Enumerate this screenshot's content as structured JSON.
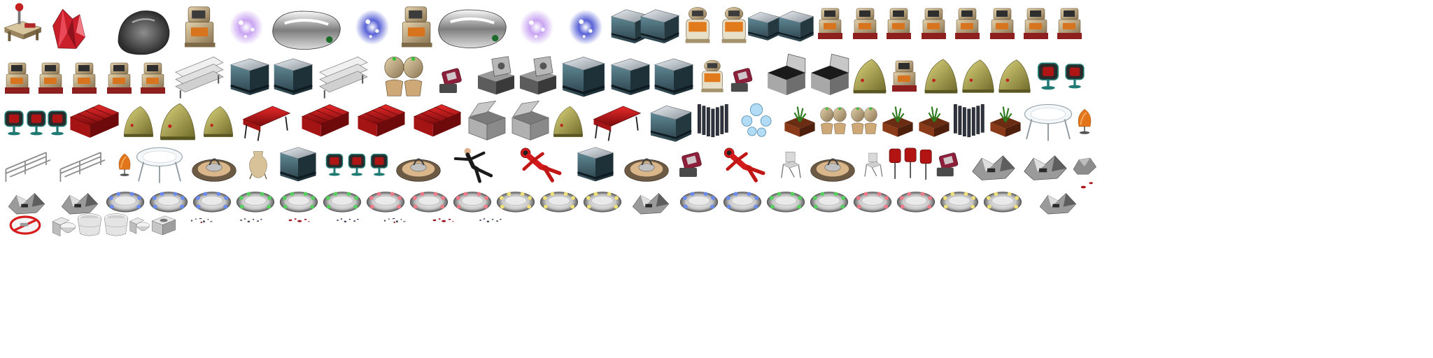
{
  "sheet": {
    "background": "#ffffff",
    "rows": [
      {
        "items": [
          "desk-lamp",
          "red-crystal",
          "gray-boulder",
          "robot-cabinet",
          "purple-sparkle",
          "chrome-pod",
          "blue-sparkle",
          "robot-cabinet",
          "chrome-pod",
          "purple-sparkle",
          "blue-sparkle",
          "counter-corner",
          "counter-corner",
          "orange-robot",
          "orange-robot",
          "counter-corner",
          "counter-corner",
          "arcade-robot",
          "arcade-robot",
          "arcade-robot",
          "arcade-robot",
          "arcade-robot",
          "arcade-robot",
          "arcade-robot",
          "arcade-robot"
        ]
      },
      {
        "items": [
          "arcade-robot",
          "arcade-robot",
          "arcade-robot",
          "arcade-robot",
          "arcade-robot",
          "park-bench",
          "steel-counter",
          "steel-counter",
          "park-bench",
          "toilet-pair",
          "red-device",
          "open-safe",
          "open-safe",
          "steel-counter",
          "steel-counter",
          "steel-counter",
          "orange-robot",
          "red-device",
          "open-box",
          "open-box",
          "olive-pod",
          "arcade-robot",
          "olive-pod",
          "olive-pod",
          "olive-pod",
          "tv-monitor",
          "tv-monitor"
        ]
      },
      {
        "items": [
          "tv-monitor",
          "tv-monitor",
          "tv-monitor",
          "red-sofa",
          "olive-pod",
          "olive-pod",
          "olive-pod",
          "red-bench",
          "red-sofa",
          "red-sofa",
          "red-sofa",
          "metal-crate",
          "metal-crate",
          "olive-pod",
          "red-bench",
          "counter-corner",
          "dark-fence",
          "bubble-cluster",
          "potted-plant",
          "toilet-pair",
          "toilet-pair",
          "potted-plant",
          "potted-plant",
          "dark-fence",
          "potted-plant",
          "glass-table",
          "orange-chair"
        ]
      },
      {
        "items": [
          "rail-fence",
          "rail-fence",
          "orange-chair",
          "glass-table",
          "teleport-pad",
          "clay-vase",
          "steel-counter",
          "tv-monitor",
          "tv-monitor",
          "tv-monitor",
          "teleport-pad",
          "man-falling",
          "red-astronaut",
          "steel-counter",
          "teleport-pad",
          "red-device",
          "red-astronaut",
          "folding-chair",
          "teleport-pad",
          "folding-chair",
          "office-chairs",
          "red-device",
          "debris-pile",
          "debris-pile",
          "rock-chunk"
        ]
      },
      {
        "items": [
          "debris-pile",
          "debris-pile",
          "pad-blue",
          "pad-blue",
          "pad-blue",
          "pad-green",
          "pad-green",
          "pad-green",
          "pad-red",
          "pad-red",
          "pad-red",
          "pad-yellow",
          "pad-yellow",
          "pad-yellow",
          "debris-pile",
          "pad-blue",
          "pad-blue",
          "pad-green",
          "pad-green",
          "pad-red",
          "pad-red",
          "pad-yellow",
          "pad-yellow",
          "debris-pile",
          "red-splat"
        ]
      },
      {
        "items": [
          "no-sign",
          "toilet",
          "tub",
          "tub",
          "toilet",
          "sink",
          "bolts-scatter",
          "pebbles-scatter",
          "blood-splat",
          "pebbles-scatter",
          "bolts-scatter",
          "blood-splat",
          "pebbles-scatter"
        ]
      }
    ]
  }
}
